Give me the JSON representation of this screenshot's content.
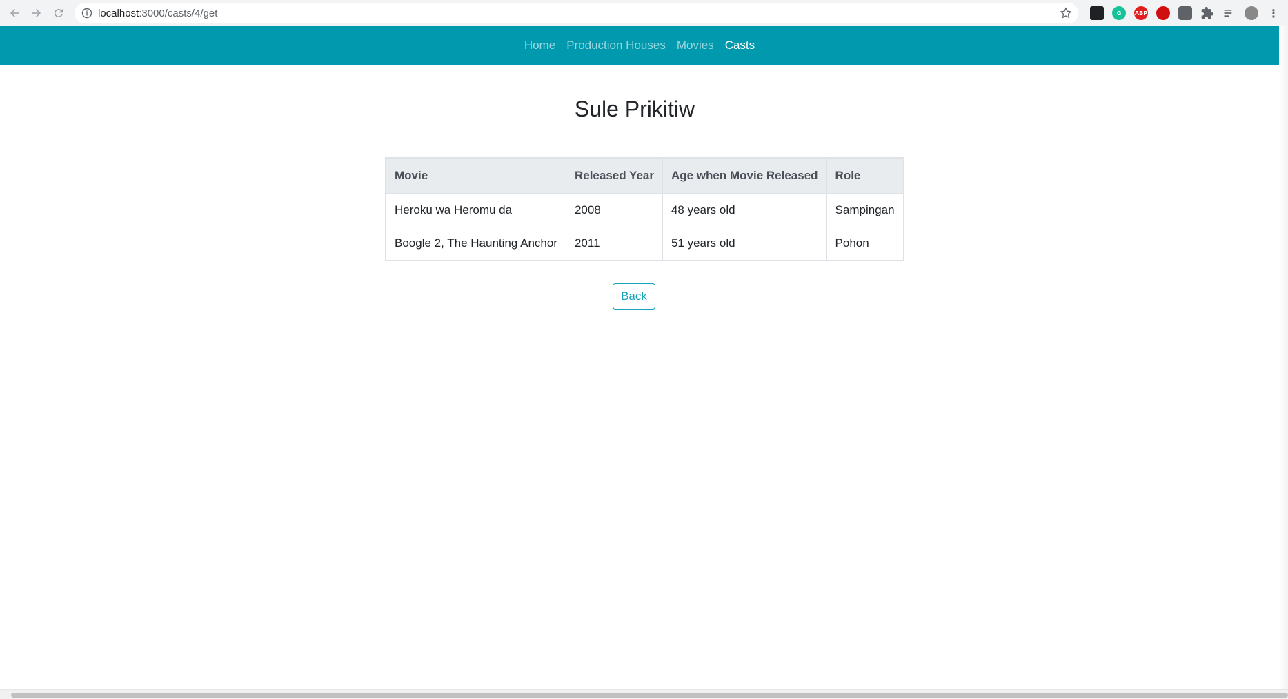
{
  "browser": {
    "url_host": "localhost",
    "url_path": ":3000/casts/4/get",
    "extensions": [
      {
        "name": "tab-manager-icon",
        "color": "#202124",
        "label": ""
      },
      {
        "name": "grammarly-icon",
        "color": "#15c39a",
        "label": "G"
      },
      {
        "name": "adblock-icon",
        "color": "#e02020",
        "label": "ABP"
      },
      {
        "name": "stop-icon",
        "color": "#d01010",
        "label": ""
      },
      {
        "name": "line-icon",
        "color": "#5f6368",
        "label": ""
      },
      {
        "name": "puzzle-icon",
        "color": "#5f6368",
        "label": ""
      },
      {
        "name": "reading-list-icon",
        "color": "#5f6368",
        "label": ""
      },
      {
        "name": "profile-avatar",
        "color": "#888888",
        "label": ""
      }
    ]
  },
  "navbar": {
    "items": [
      {
        "label": "Home",
        "active": false
      },
      {
        "label": "Production Houses",
        "active": false
      },
      {
        "label": "Movies",
        "active": false
      },
      {
        "label": "Casts",
        "active": true
      }
    ],
    "color": "#0099ad"
  },
  "page": {
    "title": "Sule Prikitiw",
    "back_label": "Back"
  },
  "table": {
    "headers": [
      "Movie",
      "Released Year",
      "Age when Movie Released",
      "Role"
    ],
    "rows": [
      [
        "Heroku wa Heromu da",
        "2008",
        "48 years old",
        "Sampingan"
      ],
      [
        "Boogle 2, The Haunting Anchor",
        "2011",
        "51 years old",
        "Pohon"
      ]
    ]
  }
}
